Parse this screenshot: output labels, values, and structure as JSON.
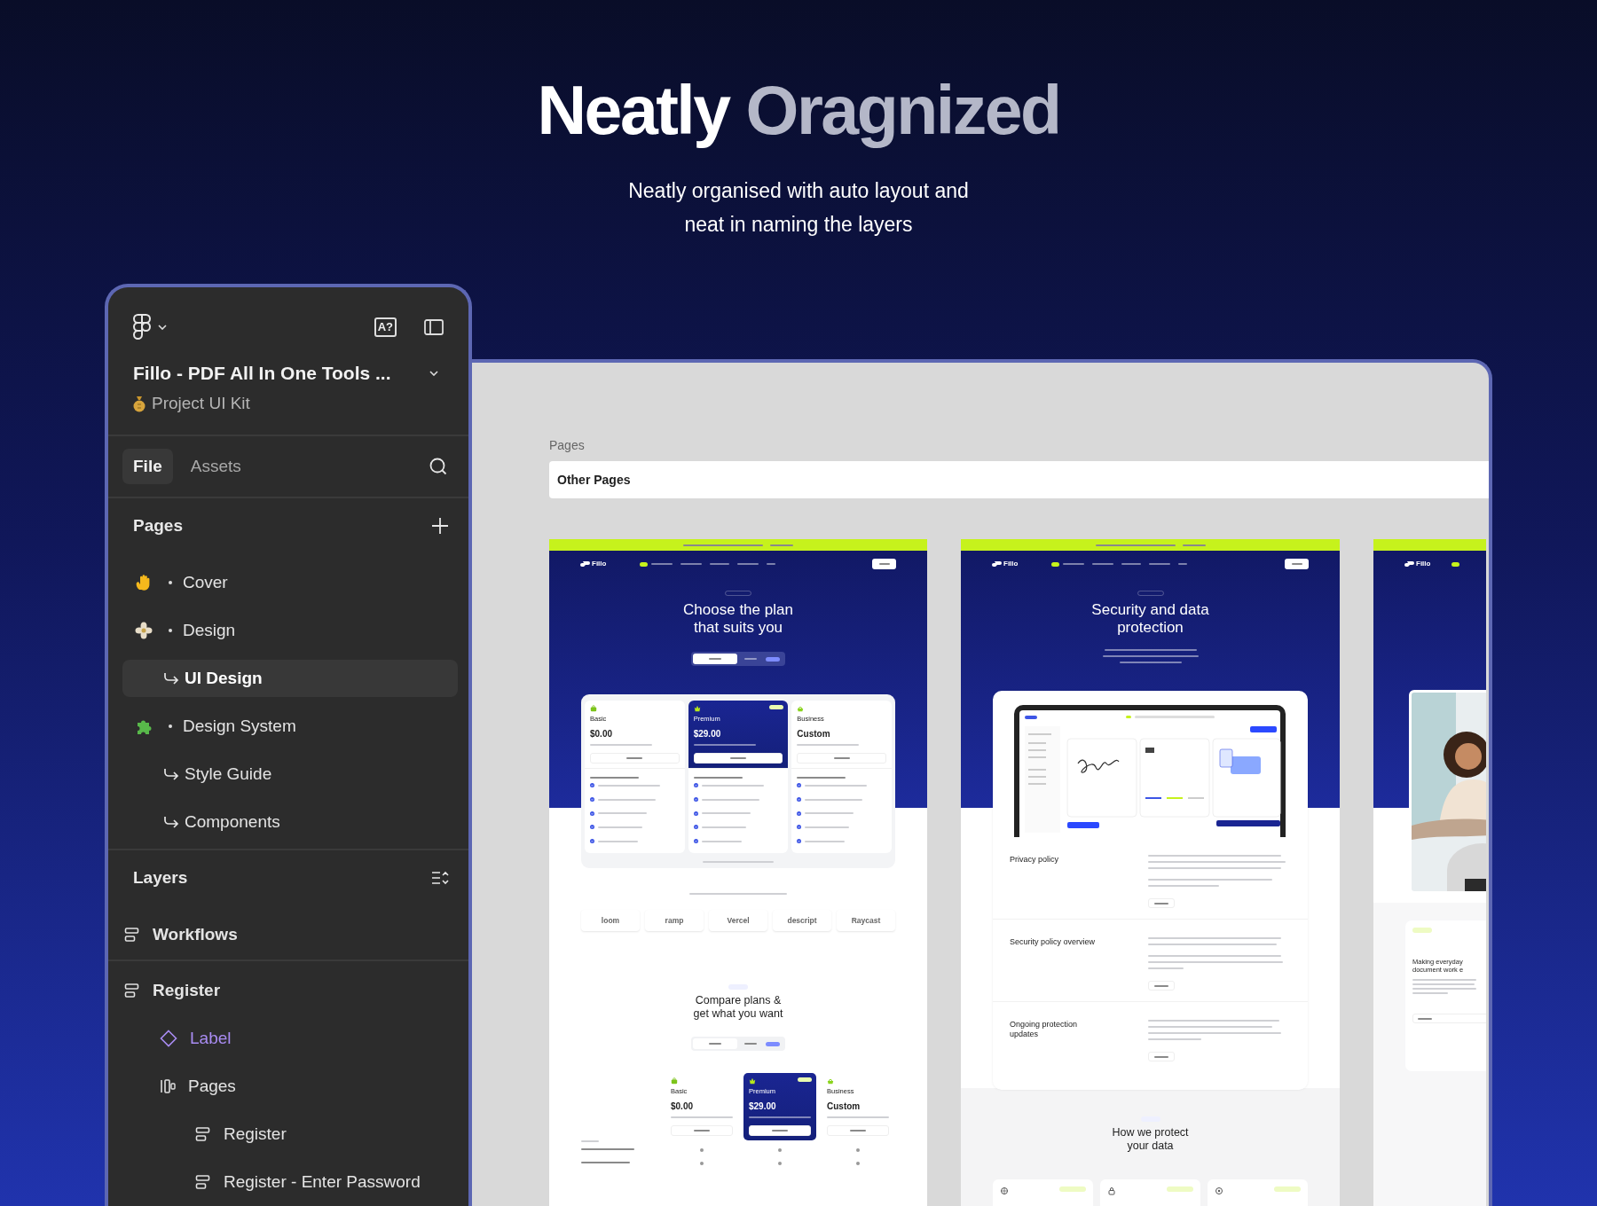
{
  "header": {
    "title_lead": "Neatly",
    "title_accent": "Oragnized",
    "subtitle_lines": [
      "Neatly organised with auto layout and",
      "neat in naming the layers"
    ]
  },
  "panel": {
    "ai_label": "A?",
    "file_title": "Fillo - PDF All In One Tools ...",
    "project": "Project UI Kit",
    "tabs": [
      {
        "label": "File",
        "selected": true
      },
      {
        "label": "Assets",
        "selected": false
      }
    ],
    "pages_title": "Pages",
    "pages": [
      {
        "label": "Cover",
        "kind": "section",
        "selected": false
      },
      {
        "label": "Design",
        "kind": "section",
        "selected": false
      },
      {
        "label": "UI Design",
        "kind": "sub",
        "selected": true
      },
      {
        "label": "Design System",
        "kind": "section",
        "selected": false
      },
      {
        "label": "Style Guide",
        "kind": "sub",
        "selected": false
      },
      {
        "label": "Components",
        "kind": "sub",
        "selected": false
      }
    ],
    "layers_title": "Layers",
    "layers": [
      {
        "label": "Workflows",
        "kind": "frame"
      },
      {
        "label": "Register",
        "kind": "frame",
        "children": [
          {
            "label": "Label",
            "kind": "component"
          },
          {
            "label": "Pages",
            "kind": "stack",
            "children": [
              {
                "label": "Register",
                "kind": "frame"
              },
              {
                "label": "Register - Enter Password",
                "kind": "frame"
              }
            ]
          }
        ]
      }
    ]
  },
  "canvas": {
    "section_label": "Pages",
    "section_value": "Other Pages",
    "mockups": [
      {
        "kind": "pricing",
        "brand": "Fillo",
        "title_lines": [
          "Choose the plan",
          "that suits you"
        ],
        "plans": [
          {
            "name": "Basic",
            "price": "$0.00",
            "featured": false
          },
          {
            "name": "Premium",
            "price": "$29.00",
            "featured": true
          },
          {
            "name": "Business",
            "price": "Custom",
            "featured": false
          }
        ],
        "logos": [
          "loom",
          "ramp",
          "Vercel",
          "descript",
          "Raycast"
        ],
        "compare": {
          "title_lines": [
            "Compare plans &",
            "get what you want"
          ],
          "plans": [
            {
              "name": "Basic",
              "price": "$0.00",
              "featured": false
            },
            {
              "name": "Premium",
              "price": "$29.00",
              "featured": true
            },
            {
              "name": "Business",
              "price": "Custom",
              "featured": false
            }
          ]
        }
      },
      {
        "kind": "security",
        "brand": "Fillo",
        "title_lines": [
          "Security and data",
          "protection"
        ],
        "policies": [
          {
            "title": "Privacy policy"
          },
          {
            "title": "Security policy overview"
          },
          {
            "title": "Ongoing protection updates"
          }
        ],
        "section": {
          "title_lines": [
            "How we protect",
            "your data"
          ]
        }
      },
      {
        "kind": "about",
        "brand": "Fillo",
        "mission": {
          "title_lines": [
            "Making everyday",
            "document work e"
          ]
        }
      }
    ]
  }
}
